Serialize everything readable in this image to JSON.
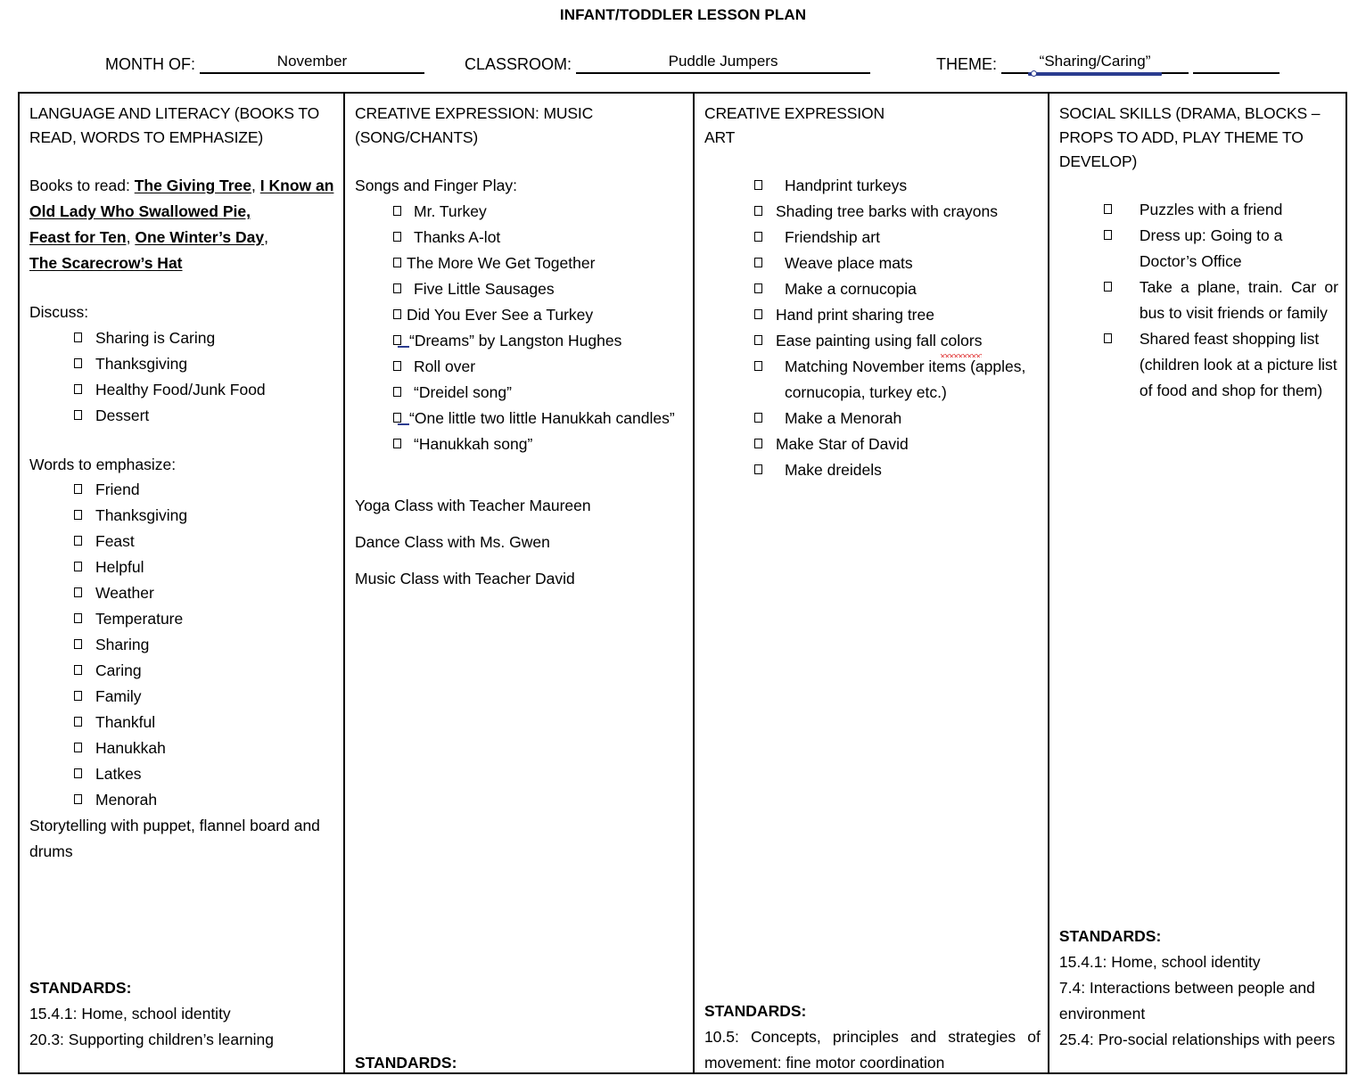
{
  "document": {
    "title": "INFANT/TODDLER LESSON PLAN"
  },
  "header_fields": {
    "month_label": "MONTH OF:",
    "month_value": "November",
    "classroom_label": "CLASSROOM:",
    "classroom_value": "Puddle Jumpers",
    "theme_label": "THEME:",
    "theme_value": "“Sharing/Caring”"
  },
  "columns": [
    {
      "heading": "LANGUAGE AND LITERACY (BOOKS TO READ, WORDS TO EMPHASIZE)",
      "books_label": "Books to read:",
      "books": [
        "The Giving Tree",
        "I Know an Old Lady Who Swallowed Pie,",
        "Feast for Ten",
        "One Winter’s Day",
        "The Scarecrow’s Hat"
      ],
      "discuss_label": "Discuss:",
      "discuss": [
        "Sharing is Caring",
        "Thanksgiving",
        "Healthy Food/Junk Food",
        "Dessert"
      ],
      "words_label": "Words to emphasize:",
      "words": [
        "Friend",
        "Thanksgiving",
        "Feast",
        "Helpful",
        "Weather",
        "Temperature",
        "Sharing",
        "Caring",
        "Family",
        "Thankful",
        "Hanukkah",
        "Latkes",
        "Menorah"
      ],
      "closing_note": "Storytelling with puppet, flannel board and drums",
      "standards_title": "STANDARDS:",
      "standards": [
        "15.4.1: Home, school identity",
        "20.3: Supporting children’s learning"
      ]
    },
    {
      "heading": "CREATIVE EXPRESSION: MUSIC (SONG/CHANTS)",
      "songs_label": "Songs and Finger Play:",
      "songs": [
        "Mr. Turkey",
        "Thanks A-lot",
        "The More We Get Together",
        "Five Little Sausages",
        "Did You Ever See a Turkey",
        "“Dreams” by Langston Hughes",
        "Roll over",
        "“Dreidel song”",
        "“One little two little Hanukkah candles”",
        "“Hanukkah song”"
      ],
      "classes": [
        "Yoga Class with Teacher Maureen",
        "Dance Class with Ms. Gwen",
        "Music Class with Teacher David"
      ],
      "standards_title": "STANDARDS:",
      "standards": []
    },
    {
      "heading": "CREATIVE EXPRESSION ART",
      "activities": [
        "Handprint turkeys",
        "Shading tree barks with crayons",
        "Friendship art",
        "Weave place mats",
        "Make a cornucopia",
        "Hand print sharing tree",
        "Ease painting using fall colors",
        "Matching November items (apples, cornucopia, turkey etc.)",
        "Make a Menorah",
        "Make Star of David",
        "Make dreidels"
      ],
      "standards_title": "STANDARDS:",
      "standards": [
        "10.5: Concepts, principles and strategies of movement: fine motor coordination"
      ]
    },
    {
      "heading": "SOCIAL SKILLS (DRAMA, BLOCKS – PROPS TO ADD, PLAY THEME TO DEVELOP)",
      "activities": [
        "Puzzles with a friend",
        "Dress up: Going to a Doctor’s Office",
        "Take a plane, train. Car or bus to visit friends or family",
        "Shared feast shopping list (children look at a picture list of food and shop for them)"
      ],
      "standards_title": "STANDARDS:",
      "standards": [
        "15.4.1: Home, school identity",
        "7.4: Interactions between people and environment",
        "25.4: Pro-social relationships with peers"
      ]
    }
  ]
}
